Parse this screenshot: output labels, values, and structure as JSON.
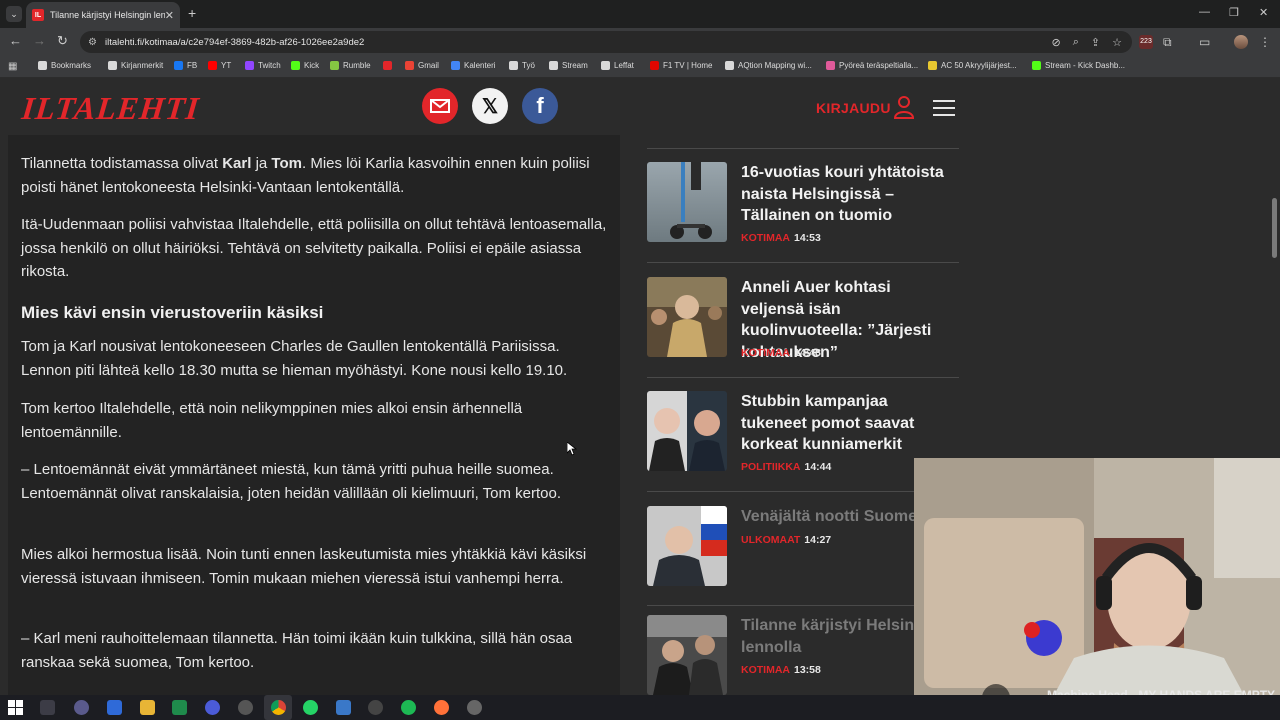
{
  "browser": {
    "tab_title": "Tilanne kärjistyi Helsingin lennolla",
    "tab_favicon": "IL",
    "url": "iltalehti.fi/kotimaa/a/c2e794ef-3869-482b-af26-1026ee2a9de2",
    "ext_badge": "223",
    "bookmarks": [
      {
        "label": "Bookmarks",
        "color": "#d9d9d9"
      },
      {
        "label": "Kirjanmerkit",
        "color": "#d9d9d9"
      },
      {
        "label": "FB",
        "color": "#1877f2"
      },
      {
        "label": "YT",
        "color": "#ff0000"
      },
      {
        "label": "Twitch",
        "color": "#9146ff"
      },
      {
        "label": "Kick",
        "color": "#53fc18"
      },
      {
        "label": "Rumble",
        "color": "#85c742"
      },
      {
        "label": "",
        "color": "#e2262a"
      },
      {
        "label": "Gmail",
        "color": "#ea4335"
      },
      {
        "label": "Kalenteri",
        "color": "#4285f4"
      },
      {
        "label": "Työ",
        "color": "#d9d9d9"
      },
      {
        "label": "Stream",
        "color": "#d9d9d9"
      },
      {
        "label": "Leffat",
        "color": "#d9d9d9"
      },
      {
        "label": "F1 TV | Home",
        "color": "#e10600"
      },
      {
        "label": "AQtion Mapping wi...",
        "color": "#d9d9d9"
      },
      {
        "label": "Pyöreä teräspeltialla...",
        "color": "#e05a9a"
      },
      {
        "label": "AC 50 Akryylijärjest...",
        "color": "#e8c830"
      },
      {
        "label": "Stream - Kick Dashb...",
        "color": "#53fc18"
      }
    ]
  },
  "site": {
    "logo": "ILTALEHTI",
    "login_label": "KIRJAUDU",
    "colors": {
      "brand": "#e2262a",
      "mail": "#e2262a",
      "x": "#f2f2f2",
      "facebook": "#3b5998"
    }
  },
  "article": {
    "p1_a": "Tilannetta todistamassa olivat ",
    "p1_b": "Karl",
    "p1_c": " ja ",
    "p1_d": "Tom",
    "p1_e": ". Mies löi Karlia kasvoihin ennen kuin poliisi poisti hänet lentokoneesta Helsinki-Vantaan lentokentällä.",
    "p2": "Itä-Uudenmaan poliisi vahvistaa Iltalehdelle, että poliisilla on ollut tehtävä lentoasemalla, jossa henkilö on ollut häiriöksi. Tehtävä on selvitetty paikalla. Poliisi ei epäile asiassa rikosta.",
    "subheading": "Mies kävi ensin vierustoveriin käsiksi",
    "p3": "Tom ja Karl nousivat lentokoneeseen Charles de Gaullen lentokentällä Pariisissa. Lennon piti lähteä kello 18.30 mutta se hieman myöhästyi. Kone nousi kello 19.10.",
    "p4": "Tom kertoo Iltalehdelle, että noin nelikymppinen mies alkoi ensin ärhennellä lentoemännille.",
    "p5": "– Lentoemännät eivät ymmärtäneet miestä, kun tämä yritti puhua heille suomea. Lentoemännät olivat ranskalaisia, joten heidän välillään oli kielimuuri, Tom kertoo.",
    "p6": "Mies alkoi hermostua lisää. Noin tunti ennen laskeutumista mies yhtäkkiä kävi käsiksi vieressä istuvaan ihmiseen. Tomin mukaan miehen vieressä istui vanhempi herra.",
    "p7": "– Karl meni rauhoittelemaan tilannetta. Hän toimi ikään kuin tulkkina, sillä hän osaa ranskaa sekä suomea, Tom kertoo."
  },
  "sidebar": {
    "items": [
      {
        "title": "16-vuotias kouri yhtätoista naista Helsingissä – Tällainen on tuomio",
        "category": "KOTIMAA",
        "time": "14:53"
      },
      {
        "title": "Anneli Auer kohtasi veljensä isän kuolinvuoteella: ”Järjesti kohtauksen”",
        "category": "KOTIMAA",
        "time": "14:48"
      },
      {
        "title": "Stubbin kampanjaa tukeneet pomot saavat korkeat kunniamerkit",
        "category": "POLITIIKKA",
        "time": "14:44"
      },
      {
        "title": "Venäjältä nootti Suomelle",
        "category": "ULKOMAAT",
        "time": "14:27"
      },
      {
        "title": "Tilanne kärjistyi Helsingin lennolla",
        "category": "KOTIMAA",
        "time": "13:58"
      }
    ]
  },
  "overlay": {
    "now_playing": "Machine Head - MY HANDS ARE EMPTY"
  }
}
